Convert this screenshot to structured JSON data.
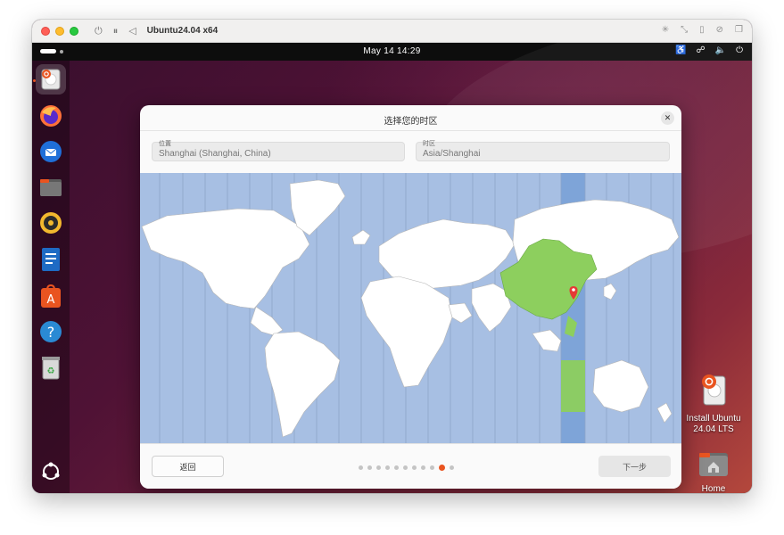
{
  "vm_window": {
    "title": "Ubuntu24.04 x64"
  },
  "top_bar": {
    "clock": "May 14  14:29"
  },
  "dock": {
    "items": [
      {
        "name": "installer-icon",
        "active": true
      },
      {
        "name": "firefox-icon"
      },
      {
        "name": "thunderbird-icon"
      },
      {
        "name": "files-icon"
      },
      {
        "name": "rhythmbox-icon"
      },
      {
        "name": "writer-icon"
      },
      {
        "name": "app-center-icon"
      },
      {
        "name": "help-icon"
      },
      {
        "name": "trash-icon"
      }
    ],
    "show_apps_icon": "ubuntu-grid-icon"
  },
  "desktop_icons": {
    "install": {
      "label_line1": "Install Ubuntu",
      "label_line2": "24.04 LTS"
    },
    "home": {
      "label": "Home"
    }
  },
  "dialog": {
    "title": "选择您的时区",
    "location_label": "位置",
    "location_value": "Shanghai (Shanghai, China)",
    "timezone_label": "时区",
    "timezone_value": "Asia/Shanghai",
    "back_label": "返回",
    "next_label": "下一步",
    "progress": {
      "total_steps": 11,
      "current_step": 10
    }
  },
  "colors": {
    "accent": "#e95420",
    "map_ocean": "#a7bfe3",
    "map_land": "#ffffff",
    "selected_country": "#8dcf5e",
    "selected_timezone_band": "#7ea4d8"
  }
}
